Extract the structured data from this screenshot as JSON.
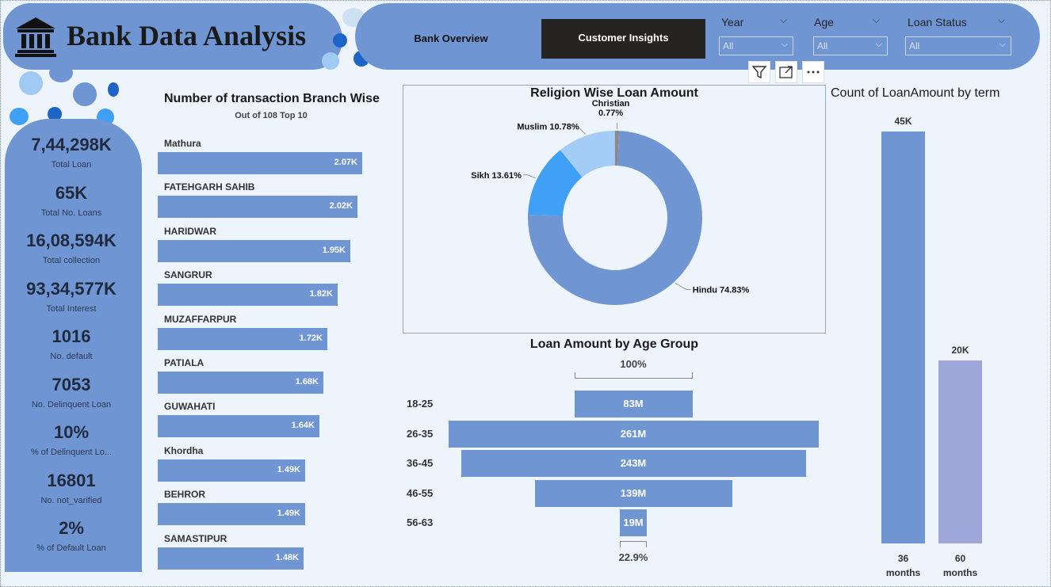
{
  "header": {
    "title": "Bank Data Analysis",
    "logo_icon": "bank-icon"
  },
  "nav": {
    "bank_overview": "Bank Overview",
    "customer_insights": "Customer Insights"
  },
  "slicers": [
    {
      "label": "Year",
      "value": "All"
    },
    {
      "label": "Age",
      "value": "All"
    },
    {
      "label": "Loan Status",
      "value": "All"
    }
  ],
  "visual_toolbar": [
    "filter-icon",
    "focus-mode-icon",
    "more-options-icon"
  ],
  "kpis": [
    {
      "value": "7,44,298K",
      "label": "Total Loan"
    },
    {
      "value": "65K",
      "label": "Total No. Loans"
    },
    {
      "value": "16,08,594K",
      "label": "Total collection"
    },
    {
      "value": "93,34,577K",
      "label": "Total Interest"
    },
    {
      "value": "1016",
      "label": "No. default"
    },
    {
      "value": "7053",
      "label": "No. Delinquent Loan"
    },
    {
      "value": "10%",
      "label": "% of Delinquent Lo..."
    },
    {
      "value": "16801",
      "label": "No. not_varified"
    },
    {
      "value": "2%",
      "label": "% of Default Loan"
    }
  ],
  "colors": {
    "accent": "#6f95d3",
    "background": "#eef4fc",
    "dark_button": "#252423",
    "lavender": "#9fa6da"
  },
  "chart_data": [
    {
      "type": "bar",
      "orientation": "horizontal",
      "title": "Number of transaction Branch Wise",
      "subtitle": "Out of 108 Top 10",
      "categories": [
        "Mathura",
        "FATEHGARH SAHIB",
        "HARIDWAR",
        "SANGRUR",
        "MUZAFFARPUR",
        "PATIALA",
        "GUWAHATI",
        "Khordha",
        "BEHROR",
        "SAMASTIPUR"
      ],
      "values": [
        2070,
        2020,
        1950,
        1820,
        1720,
        1680,
        1640,
        1490,
        1490,
        1480
      ],
      "labels": [
        "2.07K",
        "2.02K",
        "1.95K",
        "1.82K",
        "1.72K",
        "1.68K",
        "1.64K",
        "1.49K",
        "1.49K",
        "1.48K"
      ]
    },
    {
      "type": "pie",
      "style": "donut",
      "title": "Religion Wise Loan Amount",
      "slices": [
        {
          "name": "Hindu",
          "value": 74.83,
          "label": "Hindu 74.83%",
          "color": "#6f95d3"
        },
        {
          "name": "Sikh",
          "value": 13.61,
          "label": "Sikh 13.61%",
          "color": "#3fa0f5"
        },
        {
          "name": "Muslim",
          "value": 10.78,
          "label": "Muslim 10.78%",
          "color": "#a3cdf7"
        },
        {
          "name": "Christian",
          "value": 0.77,
          "label_lines": [
            "Christian",
            "0.77%"
          ],
          "color": "#8a8a8a"
        }
      ]
    },
    {
      "type": "bar",
      "style": "funnel",
      "title": "Loan Amount by Age Group",
      "categories": [
        "18-25",
        "26-35",
        "36-45",
        "46-55",
        "56-63"
      ],
      "values": [
        83,
        261,
        243,
        139,
        19
      ],
      "unit": "M",
      "labels": [
        "83M",
        "261M",
        "243M",
        "139M",
        "19M"
      ],
      "top_percent": "100%",
      "bottom_percent": "22.9%"
    },
    {
      "type": "bar",
      "title": "Count of LoanAmount by term",
      "categories": [
        [
          "36",
          "months"
        ],
        [
          "60",
          "months"
        ]
      ],
      "values": [
        45000,
        20000
      ],
      "labels": [
        "45K",
        "20K"
      ],
      "colors": [
        "#6f95d3",
        "#9fa6da"
      ]
    }
  ]
}
